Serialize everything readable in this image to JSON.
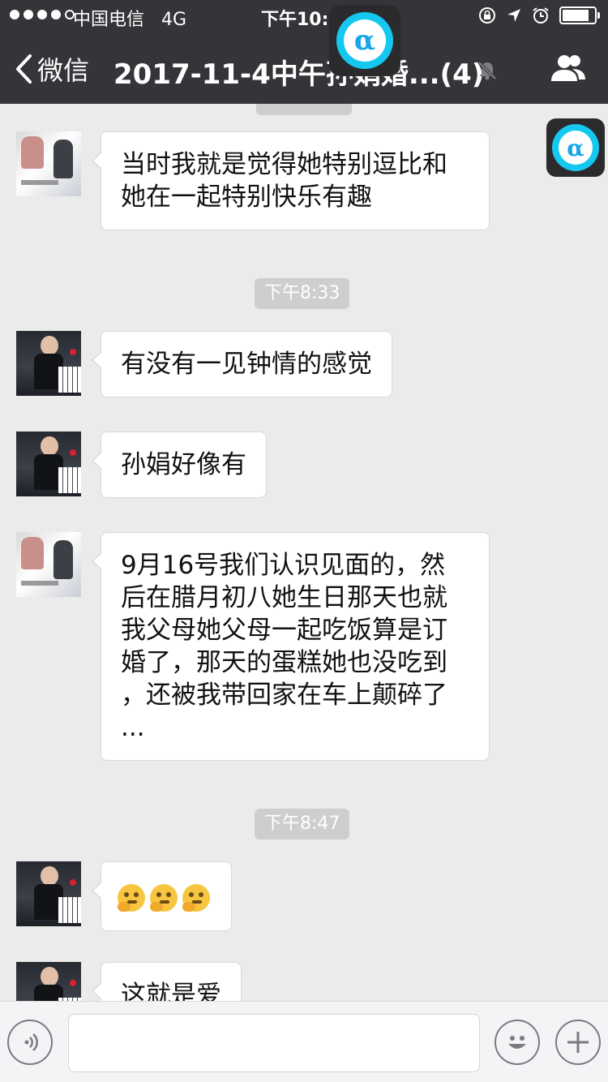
{
  "status_bar": {
    "carrier": "中国电信",
    "network": "4G",
    "time": "下午10:18",
    "signal_bars": 4,
    "battery_level": 0.85,
    "icons": [
      "lock-rotation-icon",
      "location-arrow-icon",
      "alarm-clock-icon",
      "battery-icon"
    ]
  },
  "nav": {
    "back_label": "微信",
    "title": "2017-11-4中午孙娟婚...(4)",
    "mute_icon": "mute-bell-icon",
    "group_icon": "group-members-icon"
  },
  "floating_button": {
    "symbol": "α",
    "color": "#16c7f0"
  },
  "messages": [
    {
      "type": "text",
      "avatar": "wedding-photo",
      "lines": [
        "当时我就是觉得她特别逗比和",
        "她在一起特别快乐有趣"
      ]
    },
    {
      "type": "time",
      "text": "下午8:33"
    },
    {
      "type": "text",
      "avatar": "piano-photo",
      "lines": [
        "有没有一见钟情的感觉"
      ]
    },
    {
      "type": "text",
      "avatar": "piano-photo",
      "lines": [
        "孙娟好像有"
      ]
    },
    {
      "type": "text",
      "avatar": "wedding-photo",
      "lines": [
        "9月16号我们认识见面的，然",
        "后在腊月初八她生日那天也就",
        "我父母她父母一起吃饭算是订",
        "婚了，那天的蛋糕她也没吃到",
        "，还被我带回家在车上颠碎了",
        "..."
      ]
    },
    {
      "type": "time",
      "text": "下午8:47"
    },
    {
      "type": "emoji",
      "avatar": "piano-photo",
      "emojis": [
        "thinking-face-emoji",
        "thinking-face-emoji",
        "thinking-face-emoji"
      ]
    },
    {
      "type": "text",
      "avatar": "piano-photo",
      "lines": [
        "这就是爱"
      ]
    }
  ],
  "input_bar": {
    "voice_icon": "voice-input-icon",
    "input_value": "",
    "emoji_icon": "emoji-smile-icon",
    "more_icon": "plus-icon"
  },
  "colors": {
    "header_bg": "#353539",
    "chat_bg": "#ebebeb",
    "bubble_bg": "#ffffff",
    "time_pill_bg": "#cecece"
  }
}
